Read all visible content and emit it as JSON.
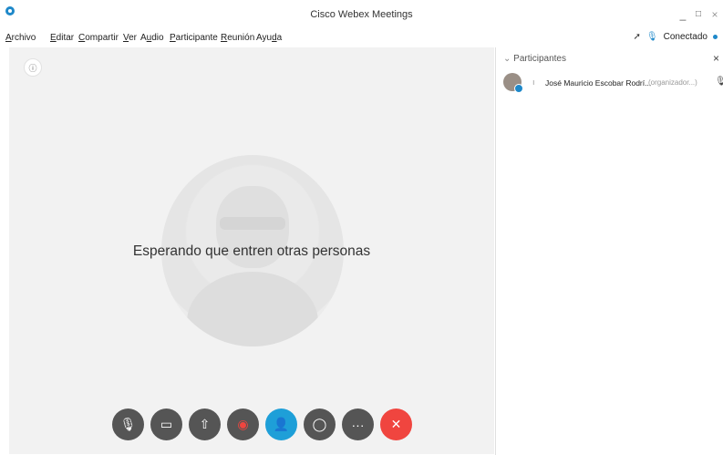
{
  "window": {
    "title": "Cisco Webex Meetings",
    "minimize": "_",
    "maximize": "□",
    "close": "×"
  },
  "menu": {
    "items": [
      {
        "u": "A",
        "rest": "rchivo"
      },
      {
        "u": "E",
        "rest": "ditar"
      },
      {
        "u": "C",
        "rest": "ompartir"
      },
      {
        "u": "V",
        "rest": "er"
      },
      {
        "u": "",
        "pre": "A",
        "u2": "u",
        "post": "dio"
      },
      {
        "u": "P",
        "rest": "articipante"
      },
      {
        "u": "R",
        "rest": "eunión"
      },
      {
        "u": "",
        "pre": "Ayu",
        "u2": "d",
        "post": "a"
      }
    ]
  },
  "status": {
    "connection": "Conectado"
  },
  "stage": {
    "waiting_message": "Esperando que entren otras personas",
    "info_icon": "ⓘ"
  },
  "controls": {
    "icons": [
      "mute-icon",
      "video-icon",
      "share-icon",
      "record-icon",
      "participants-icon",
      "chat-icon",
      "more-icon",
      "leave-icon"
    ],
    "glyphs": [
      "🎙",
      "▭",
      "⇧",
      "◉",
      "👤",
      "◯",
      "···",
      "✕"
    ],
    "colors": {
      "dark": "#555555",
      "active": "#1e9fd8",
      "leave": "#f0453f"
    }
  },
  "panel": {
    "header": "Participantes",
    "close": "×",
    "participants": [
      {
        "name": "José Mauricio Escobar Rodrí...",
        "role": "(organizador...)"
      }
    ]
  }
}
